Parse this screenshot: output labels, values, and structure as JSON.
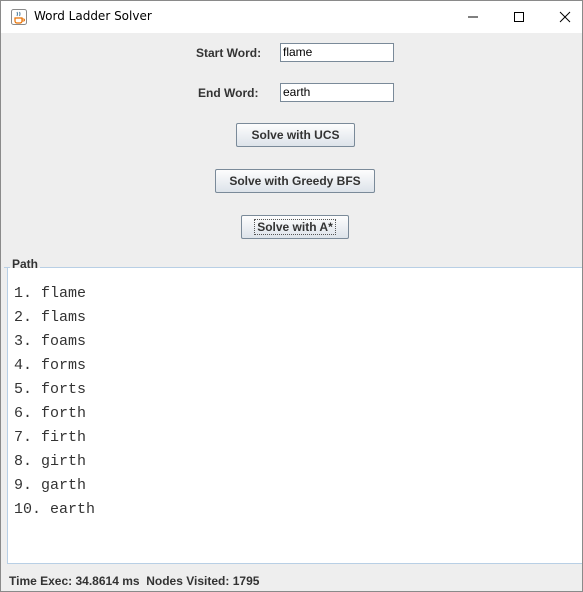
{
  "window": {
    "title": "Word Ladder Solver",
    "icon": "java-cup-icon"
  },
  "form": {
    "start_label": "Start Word:",
    "start_value": "flame",
    "end_label": "End Word:",
    "end_value": "earth"
  },
  "buttons": {
    "ucs": "Solve with UCS",
    "greedy": "Solve with Greedy BFS",
    "astar": "Solve with A*"
  },
  "path": {
    "title": "Path",
    "steps": [
      "1. flame",
      "2. flams",
      "3. foams",
      "4. forms",
      "5. forts",
      "6. forth",
      "7. firth",
      "8. girth",
      "9. garth",
      "10. earth"
    ]
  },
  "status": {
    "time_label": "Time Exec:",
    "time_value": "34.8614 ms",
    "nodes_label": "Nodes Visited:",
    "nodes_value": "1795"
  }
}
